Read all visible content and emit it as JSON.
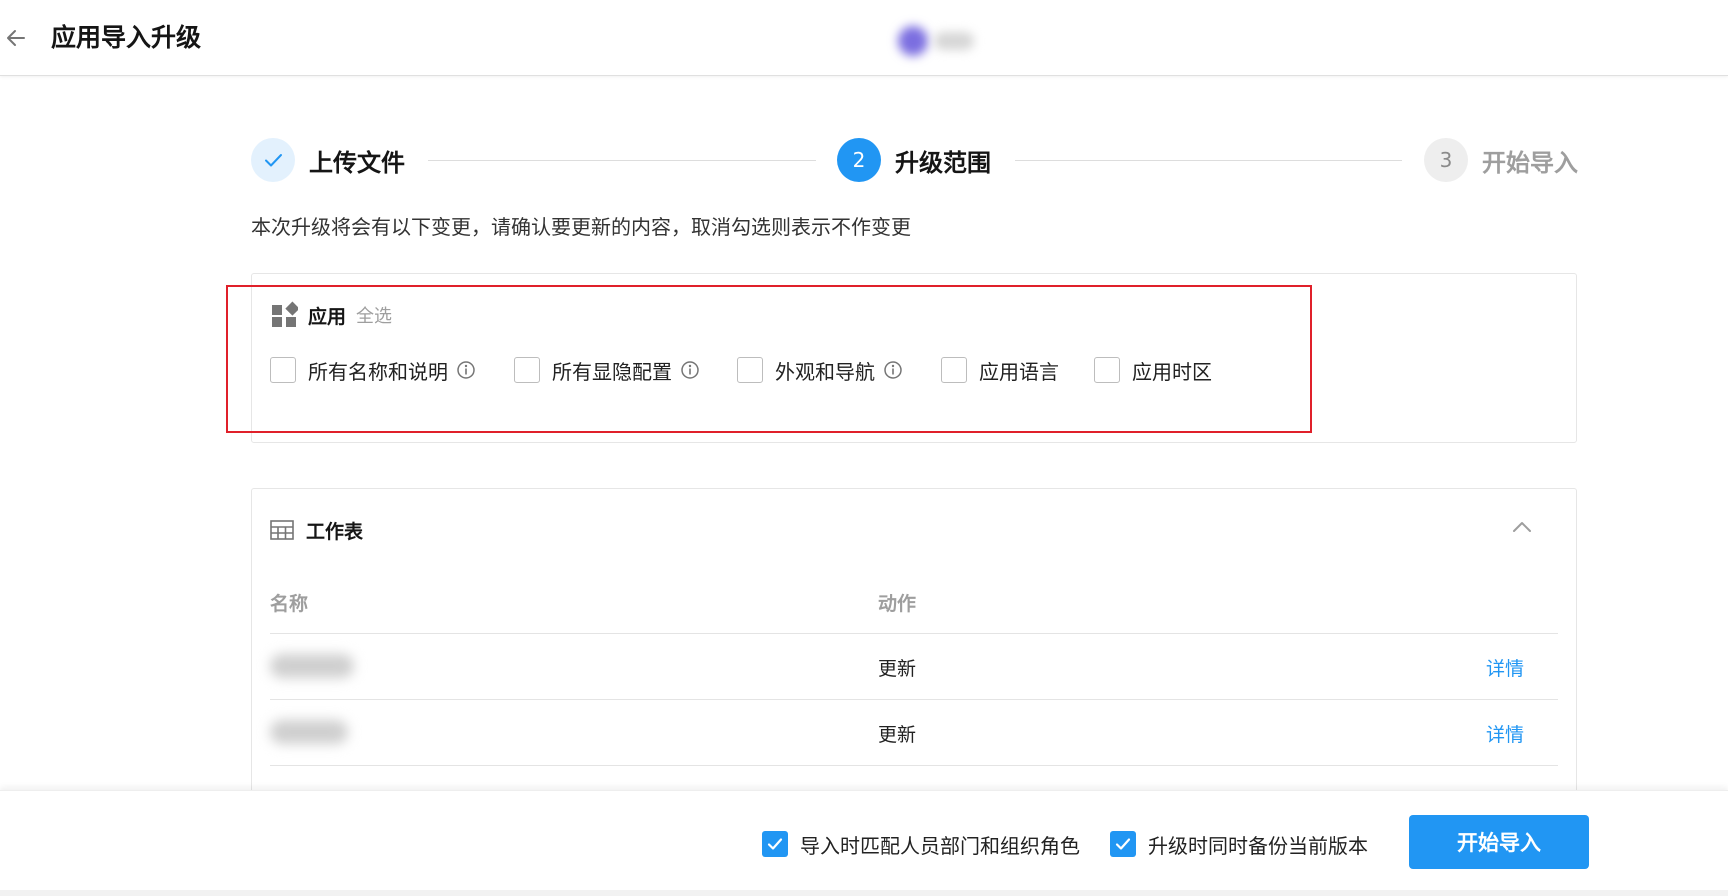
{
  "header": {
    "title": "应用导入升级",
    "back_icon": "arrow-left-icon"
  },
  "stepper": {
    "steps": [
      {
        "number": "",
        "label": "上传文件",
        "status": "done"
      },
      {
        "number": "2",
        "label": "升级范围",
        "status": "active"
      },
      {
        "number": "3",
        "label": "开始导入",
        "status": "pending"
      }
    ]
  },
  "instructions": "本次升级将会有以下变更，请确认要更新的内容，取消勾选则表示不作变更",
  "app_section": {
    "title": "应用",
    "select_all": "全选",
    "options": [
      {
        "label": "所有名称和说明",
        "has_info": true,
        "checked": false
      },
      {
        "label": "所有显隐配置",
        "has_info": true,
        "checked": false
      },
      {
        "label": "外观和导航",
        "has_info": true,
        "checked": false
      },
      {
        "label": "应用语言",
        "has_info": false,
        "checked": false
      },
      {
        "label": "应用时区",
        "has_info": false,
        "checked": false
      }
    ]
  },
  "worksheet_section": {
    "title": "工作表",
    "columns": {
      "name": "名称",
      "action": "动作"
    },
    "rows": [
      {
        "action": "更新",
        "details": "详情"
      },
      {
        "action": "更新",
        "details": "详情"
      }
    ]
  },
  "footer": {
    "options": [
      {
        "label": "导入时匹配人员部门和组织角色",
        "checked": true
      },
      {
        "label": "升级时同时备份当前版本",
        "checked": true
      }
    ],
    "start_button": "开始导入"
  },
  "colors": {
    "primary": "#2196f3",
    "highlight": "#e0202a",
    "step_done_bg": "#e3f1fd"
  }
}
